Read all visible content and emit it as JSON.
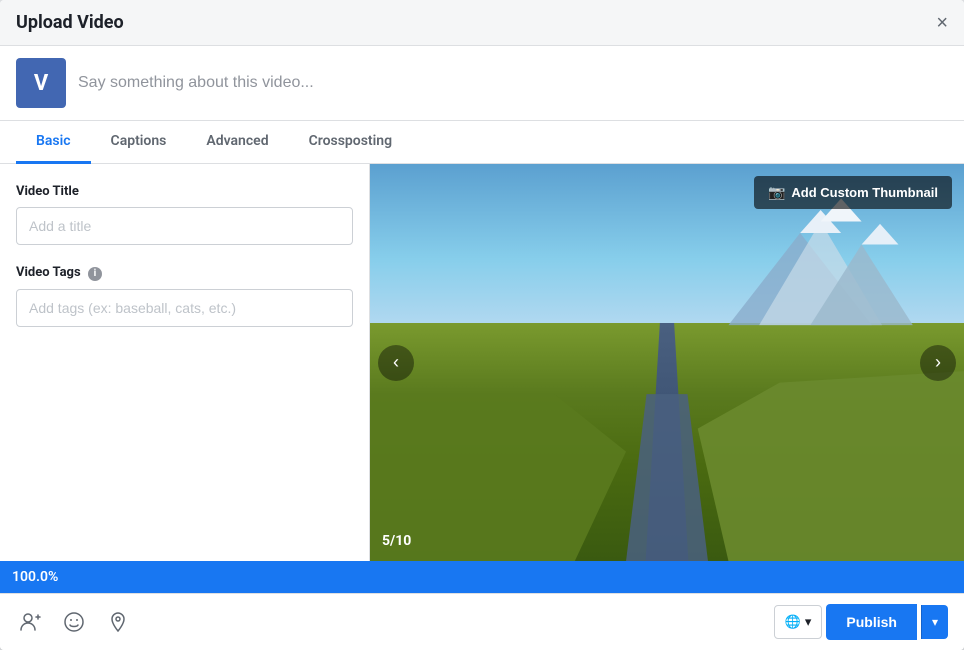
{
  "modal": {
    "title": "Upload Video",
    "close_label": "×"
  },
  "status": {
    "avatar_letter": "V",
    "placeholder": "Say something about this video..."
  },
  "tabs": [
    {
      "id": "basic",
      "label": "Basic",
      "active": true
    },
    {
      "id": "captions",
      "label": "Captions",
      "active": false
    },
    {
      "id": "advanced",
      "label": "Advanced",
      "active": false
    },
    {
      "id": "crossposting",
      "label": "Crossposting",
      "active": false
    }
  ],
  "form": {
    "title_label": "Video Title",
    "title_placeholder": "Add a title",
    "tags_label": "Video Tags",
    "tags_info": "i",
    "tags_placeholder": "Add tags (ex: baseball, cats, etc.)"
  },
  "video": {
    "thumbnail_btn": "Add Custom Thumbnail",
    "slide_counter": "5/10"
  },
  "progress": {
    "value": "100.0%"
  },
  "footer": {
    "audience_icon": "🌐",
    "audience_dropdown": "▾",
    "publish_label": "Publish",
    "publish_dropdown": "▾"
  }
}
